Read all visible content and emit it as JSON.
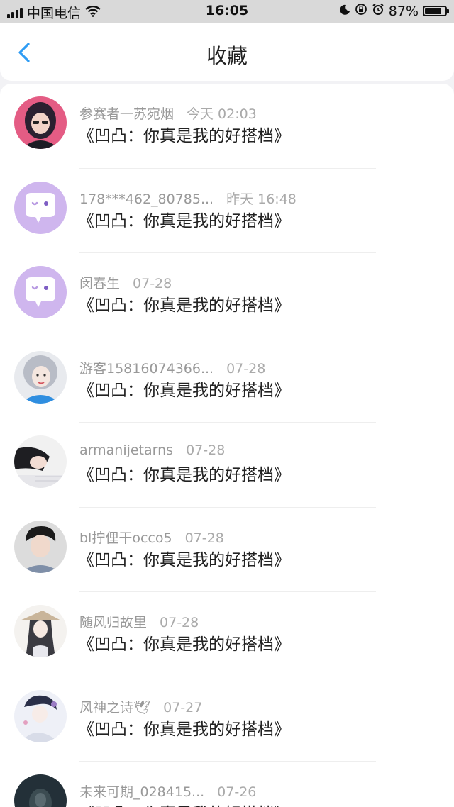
{
  "status_bar": {
    "carrier": "中国电信",
    "time": "16:05",
    "battery": "87%",
    "battery_level": 0.87
  },
  "nav": {
    "title": "收藏"
  },
  "items": [
    {
      "name": "参赛者一苏宛烟",
      "time": "今天 02:03",
      "title": "《凹凸：你真是我的好搭档》",
      "avatar": "photo-dark-hair"
    },
    {
      "name": "178***462_80785...",
      "time": "昨天 16:48",
      "title": "《凹凸：你真是我的好搭档》",
      "avatar": "default-chat-bubble"
    },
    {
      "name": "闵春生",
      "time": "07-28",
      "title": "《凹凸：你真是我的好搭档》",
      "avatar": "default-chat-bubble"
    },
    {
      "name": "游客15816074366...",
      "time": "07-28",
      "title": "《凹凸：你真是我的好搭档》",
      "avatar": "photo-gray-hair"
    },
    {
      "name": "armanijetarns",
      "time": "07-28",
      "title": "《凹凸：你真是我的好搭档》",
      "avatar": "photo-girl-lying"
    },
    {
      "name": "bl拧俚干occo5",
      "time": "07-28",
      "title": "《凹凸：你真是我的好搭档》",
      "avatar": "photo-young-man"
    },
    {
      "name": "随风归故里",
      "time": "07-28",
      "title": "《凹凸：你真是我的好搭档》",
      "avatar": "photo-anime-hat"
    },
    {
      "name": "风神之诗🕊",
      "time": "07-27",
      "title": "《凹凸：你真是我的好搭档》",
      "avatar": "photo-anime-white"
    },
    {
      "name": "未来可期_028415...",
      "time": "07-26",
      "title": "《凹凸：你真是我的好搭档》",
      "avatar": "photo-dark"
    }
  ]
}
